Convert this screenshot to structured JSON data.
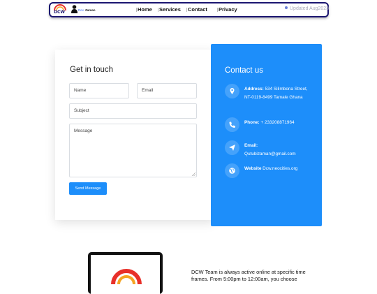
{
  "nav": {
    "logo_text": "DCW",
    "user_tag": "Dev",
    "user_name": "Zaman",
    "links": [
      "Home",
      "Services",
      "Contact",
      "Privacy"
    ],
    "updated": "Updated Aug2023"
  },
  "form": {
    "title": "Get in touch",
    "name_placeholder": "Name",
    "email_placeholder": "Email",
    "subject_placeholder": "Subject",
    "message_placeholder": "Message",
    "send_label": "Send Message"
  },
  "contact": {
    "title": "Contact us",
    "address_label": "Address:",
    "address_value": "534 Silimbona Street, NT-0119-8499 Tamale Ghana",
    "phone_label": "Phone:",
    "phone_value": "+ 233208871964",
    "email_label": "Email:",
    "email_value": "Qutubizaman@gmail.com",
    "website_label": "Website",
    "website_value": "Dcw.neocities.org"
  },
  "about": {
    "text": "DCW Team is always active online at specific time frames. From 5:00pm to 12:00am, you choose"
  },
  "colors": {
    "accent": "#1d8efa",
    "nav_border": "#1a1570"
  }
}
